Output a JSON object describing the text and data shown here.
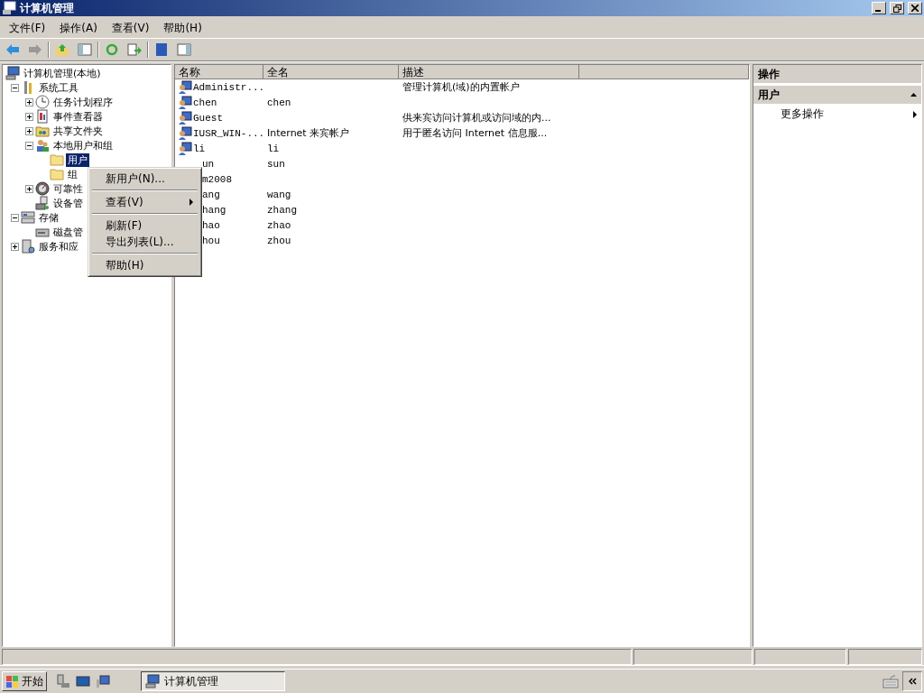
{
  "window": {
    "title": "计算机管理"
  },
  "menubar": [
    "文件(F)",
    "操作(A)",
    "查看(V)",
    "帮助(H)"
  ],
  "tree": [
    {
      "text": "计算机管理(本地)",
      "selected": false,
      "children": [
        {
          "text": "系统工具",
          "expanded": true,
          "selected": false,
          "children": [
            {
              "text": "任务计划程序",
              "expanded": false,
              "selected": false
            },
            {
              "text": "事件查看器",
              "expanded": false,
              "selected": false
            },
            {
              "text": "共享文件夹",
              "expanded": false,
              "selected": false
            },
            {
              "text": "本地用户和组",
              "expanded": true,
              "selected": false,
              "children": [
                {
                  "text": "用户",
                  "selected": true
                },
                {
                  "text": "组",
                  "selected": false
                }
              ]
            },
            {
              "text": "可靠性",
              "expanded": false,
              "selected": false
            },
            {
              "text": "设备管",
              "selected": false
            }
          ]
        },
        {
          "text": "存储",
          "expanded": true,
          "selected": false,
          "children": [
            {
              "text": "磁盘管",
              "selected": false
            }
          ]
        },
        {
          "text": "服务和应",
          "expanded": false,
          "selected": false
        }
      ]
    }
  ],
  "list": {
    "columns": [
      "名称",
      "全名",
      "描述"
    ],
    "rows": [
      {
        "name": "Administr...",
        "full_name": "",
        "description": "管理计算机(域)的内置帐户",
        "icon": true
      },
      {
        "name": "chen",
        "full_name": "chen",
        "description": "",
        "icon": true
      },
      {
        "name": "Guest",
        "full_name": "",
        "description": "供来宾访问计算机或访问域的内...",
        "icon": true
      },
      {
        "name": "IUSR_WIN-...",
        "full_name": "Internet 来宾帐户",
        "description": "用于匿名访问 Internet 信息服...",
        "icon": true
      },
      {
        "name": "li",
        "full_name": "li",
        "description": "",
        "icon": true
      },
      {
        "name": "un",
        "full_name": "sun",
        "description": "",
        "icon": false
      },
      {
        "name": "m2008",
        "full_name": "",
        "description": "",
        "icon": false
      },
      {
        "name": "ang",
        "full_name": "wang",
        "description": "",
        "icon": false
      },
      {
        "name": "hang",
        "full_name": "zhang",
        "description": "",
        "icon": false
      },
      {
        "name": "hao",
        "full_name": "zhao",
        "description": "",
        "icon": false
      },
      {
        "name": "hou",
        "full_name": "zhou",
        "description": "",
        "icon": false
      }
    ]
  },
  "actions": {
    "header": "操作",
    "section": {
      "title": "用户",
      "expanded": true
    },
    "items": [
      {
        "text": "更多操作",
        "kind": "submenu"
      }
    ]
  },
  "context_menu": [
    {
      "kind": "item",
      "text": "新用户(N)..."
    },
    {
      "kind": "separator"
    },
    {
      "kind": "submenu",
      "text": "查看(V)"
    },
    {
      "kind": "separator"
    },
    {
      "kind": "item",
      "text": "刷新(F)"
    },
    {
      "kind": "item",
      "text": "导出列表(L)..."
    },
    {
      "kind": "separator"
    },
    {
      "kind": "item",
      "text": "帮助(H)"
    }
  ],
  "taskbar": {
    "start": "开始",
    "tasks": [
      {
        "text": "计算机管理",
        "selected": true
      }
    ]
  }
}
